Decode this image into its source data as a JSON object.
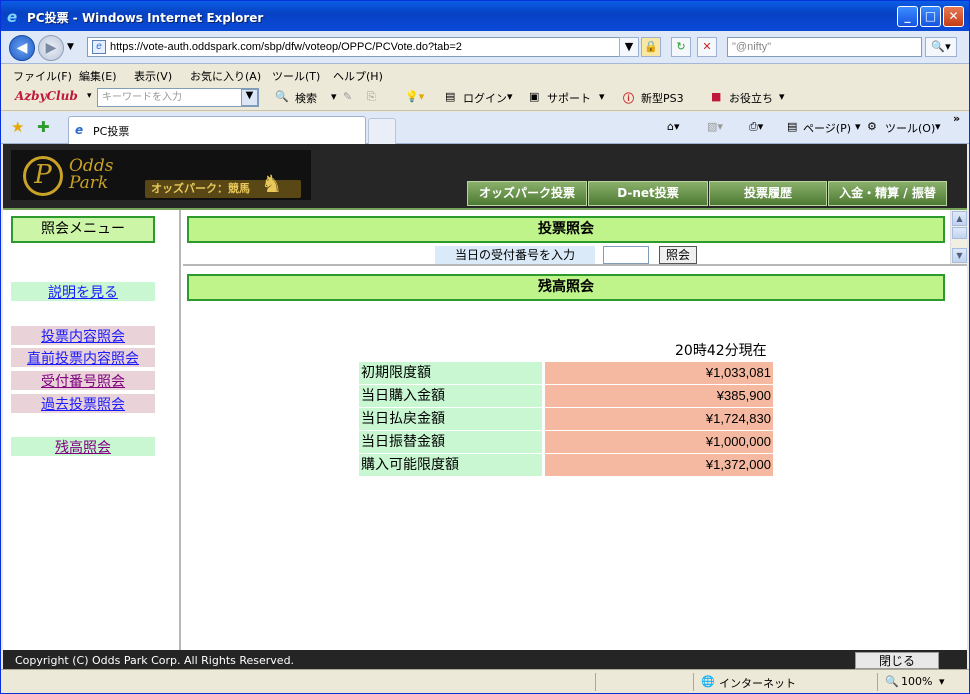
{
  "window": {
    "title": "PC投票 - Windows Internet Explorer"
  },
  "address": {
    "url": "https://vote-auth.oddspark.com/sbp/dfw/voteop/OPPC/PCVote.do?tab=2",
    "search_placeholder": "\"@nifty\""
  },
  "menu": [
    "ファイル(F)",
    "編集(E)",
    "表示(V)",
    "お気に入り(A)",
    "ツール(T)",
    "ヘルプ(H)"
  ],
  "toolbar": {
    "brand": "AzbyClub",
    "keyword_placeholder": "キーワードを入力",
    "search_label": "検索",
    "login_label": "ログイン",
    "support_label": "サポート",
    "ps3_label": "新型PS3",
    "useful_label": "お役立ち"
  },
  "tab": {
    "title": "PC投票",
    "page_label": "ページ(P)",
    "tools_label": "ツール(O)"
  },
  "site": {
    "logo_line1": "Odds",
    "logo_line2": "Park",
    "logo_badge": "オッズパーク：競馬",
    "nav": [
      "オッズパーク投票",
      "D-net投票",
      "投票履歴",
      "入金・精算 / 振替"
    ]
  },
  "left_menu": {
    "header": "照会メニュー",
    "help": "説明を見る",
    "items": [
      "投票内容照会",
      "直前投票内容照会",
      "受付番号照会",
      "過去投票照会"
    ],
    "balance": "残高照会"
  },
  "top_frame": {
    "title": "投票照会",
    "input_label": "当日の受付番号を入力",
    "query_button": "照会"
  },
  "main_frame": {
    "title": "残高照会",
    "timestamp": "20時42分現在",
    "rows": [
      {
        "label": "初期限度額",
        "value": "¥1,033,081"
      },
      {
        "label": "当日購入金額",
        "value": "¥385,900"
      },
      {
        "label": "当日払戻金額",
        "value": "¥1,724,830"
      },
      {
        "label": "当日振替金額",
        "value": "¥1,000,000"
      },
      {
        "label": "購入可能限度額",
        "value": "¥1,372,000"
      }
    ]
  },
  "footer": {
    "copyright": "Copyright (C) Odds Park Corp. All Rights Reserved.",
    "close_button": "閉じる"
  },
  "status": {
    "zone": "インターネット",
    "zoom": "100%"
  }
}
